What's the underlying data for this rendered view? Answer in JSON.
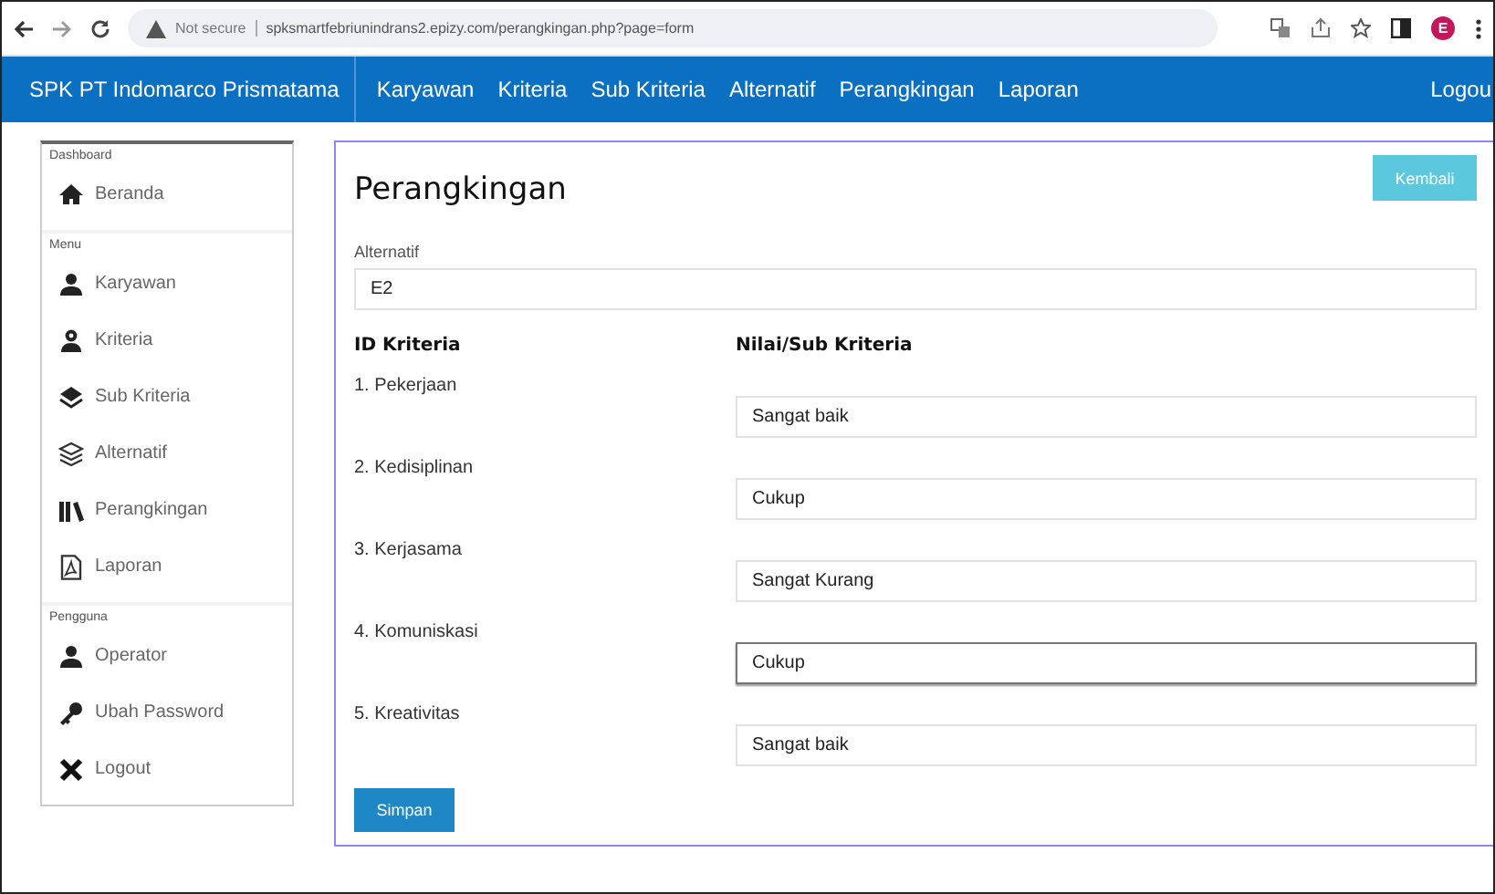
{
  "browser": {
    "security": "Not secure",
    "url": "spksmartfebriunindrans2.epizy.com/perangkingan.php?page=form",
    "profile": "E"
  },
  "navbar": {
    "brand": "SPK PT Indomarco Prismatama",
    "items": [
      "Karyawan",
      "Kriteria",
      "Sub Kriteria",
      "Alternatif",
      "Perangkingan",
      "Laporan"
    ],
    "logout": "Logou"
  },
  "sidebar": [
    {
      "heading": "Dashboard",
      "items": [
        "Beranda"
      ]
    },
    {
      "heading": "Menu",
      "items": [
        "Karyawan",
        "Kriteria",
        "Sub Kriteria",
        "Alternatif",
        "Perangkingan",
        "Laporan"
      ]
    },
    {
      "heading": "Pengguna",
      "items": [
        "Operator",
        "Ubah Password",
        "Logout"
      ]
    }
  ],
  "form": {
    "title": "Perangkingan",
    "back_button": "Kembali",
    "alternative_label": "Alternatif",
    "alternative_value": "E2",
    "columns": [
      "ID Kriteria",
      "Nilai/Sub Kriteria"
    ],
    "rows": [
      {
        "criterion": "1. Pekerjaan",
        "value": "Sangat baik",
        "focused": false
      },
      {
        "criterion": "2. Kedisiplinan",
        "value": "Cukup",
        "focused": false
      },
      {
        "criterion": "3. Kerjasama",
        "value": "Sangat Kurang",
        "focused": false
      },
      {
        "criterion": "4. Komuniskasi",
        "value": "Cukup",
        "focused": true
      },
      {
        "criterion": "5. Kreativitas",
        "value": "Sangat baik",
        "focused": false
      }
    ],
    "save_button": "Simpan"
  }
}
